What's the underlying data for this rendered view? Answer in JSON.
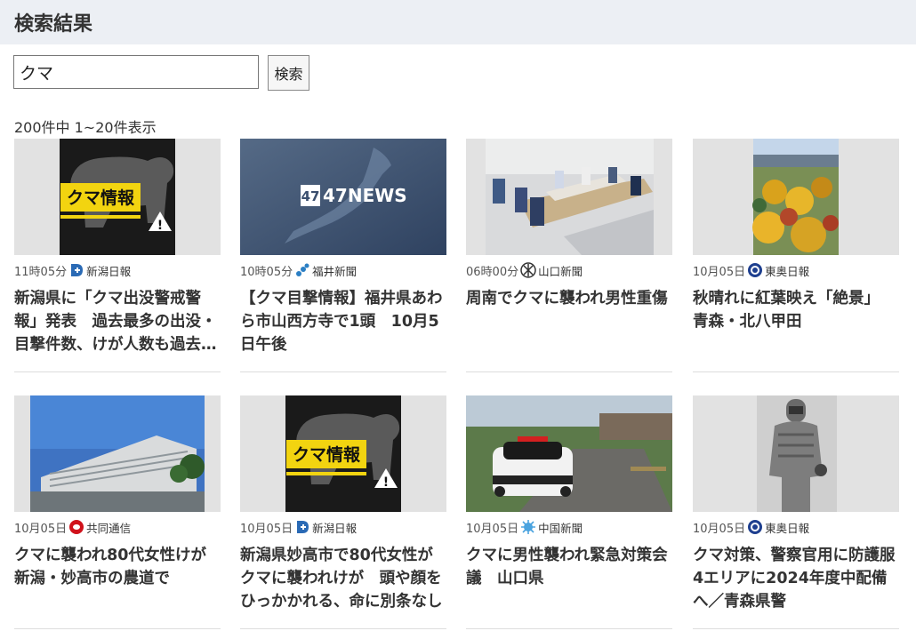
{
  "header": {
    "title": "検索結果"
  },
  "search": {
    "value": "クマ",
    "button_label": "検索"
  },
  "results_count": "200件中 1~20件表示",
  "results": [
    {
      "time": "11時05分",
      "source": "新潟日報",
      "title": "新潟県に「クマ出没警戒警報」発表　過去最多の出没・目撃件数、けが人数も過去最多",
      "image": "bear-info-card",
      "thumb_text": "クマ情報"
    },
    {
      "time": "10時05分",
      "source": "福井新聞",
      "title": "【クマ目撃情報】福井県あわら市山西方寺で1頭　10月5日午後",
      "image": "47news-logo",
      "thumb_text": "47NEWS"
    },
    {
      "time": "06時00分",
      "source": "山口新聞",
      "title": "周南でクマに襲われ男性重傷",
      "image": "meeting-room-photo"
    },
    {
      "time": "10月05日",
      "source": "東奥日報",
      "title": "秋晴れに紅葉映え「絶景」　青森・北八甲田",
      "image": "autumn-leaves-photo"
    },
    {
      "time": "10月05日",
      "source": "共同通信",
      "title": "クマに襲われ80代女性けが　新潟・妙高市の農道で",
      "image": "building-photo"
    },
    {
      "time": "10月05日",
      "source": "新潟日報",
      "title": "新潟県妙高市で80代女性がクマに襲われけが　頭や顔をひっかかれる、命に別条なし",
      "image": "bear-info-card",
      "thumb_text": "クマ情報"
    },
    {
      "time": "10月05日",
      "source": "中国新聞",
      "title": "クマに男性襲われ緊急対策会議　山口県",
      "image": "police-car-photo"
    },
    {
      "time": "10月05日",
      "source": "東奥日報",
      "title": "クマ対策、警察官用に防護服　4エリアに2024年度中配備へ／青森県警",
      "image": "protective-suit-photo"
    }
  ]
}
